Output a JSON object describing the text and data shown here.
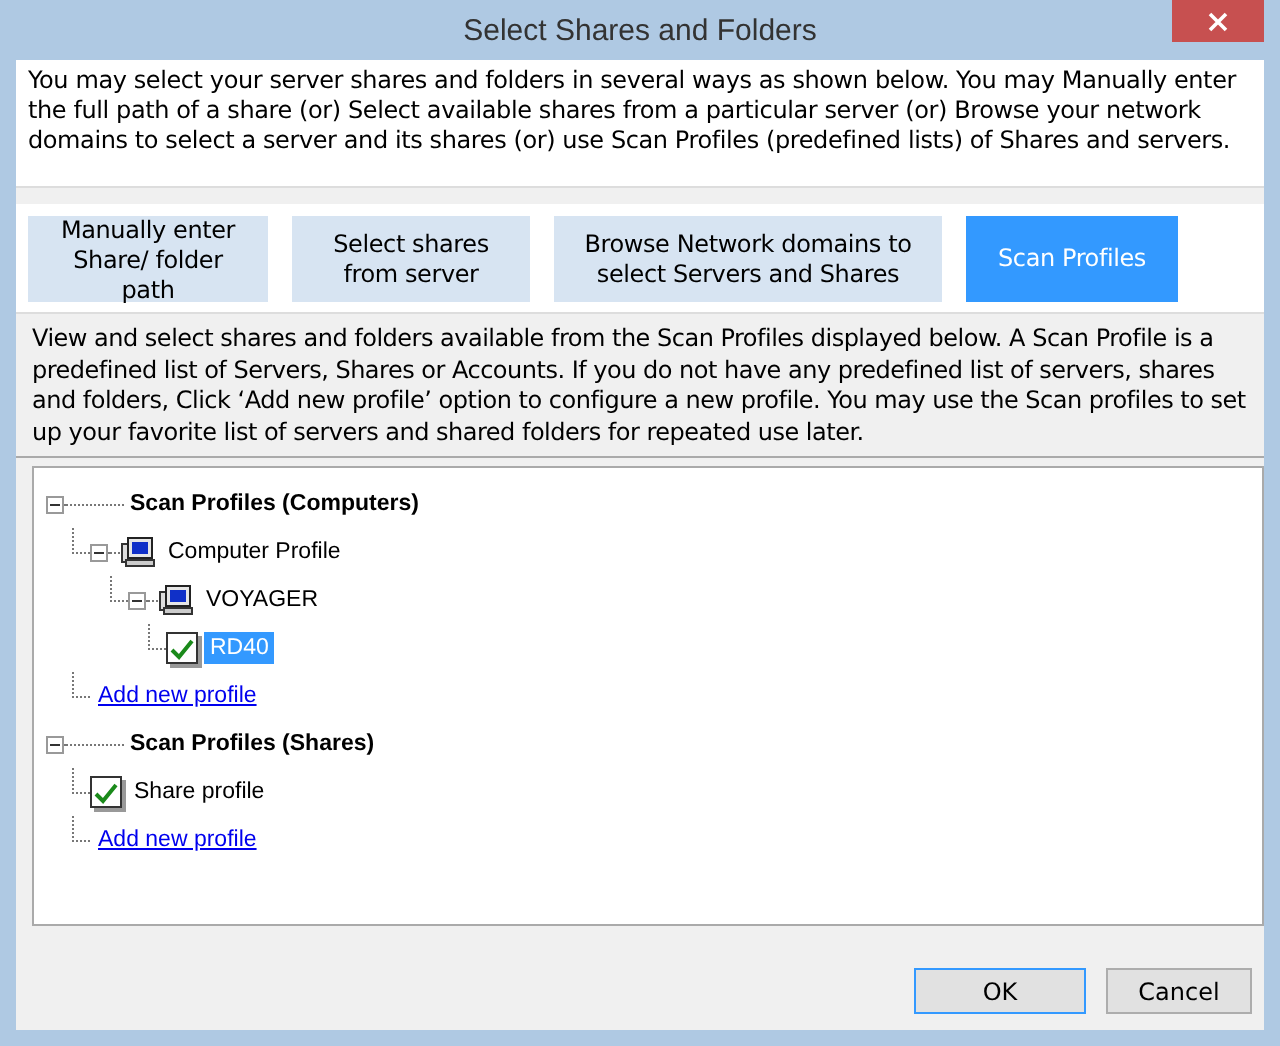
{
  "window": {
    "title": "Select Shares and Folders"
  },
  "intro": "You may select your server shares and folders in several ways as shown below. You may Manually enter the full path of a share (or) Select available shares from a particular server (or) Browse your network domains to select a server and its shares (or) use Scan Profiles (predefined lists) of Shares and servers.",
  "tabs": [
    {
      "label": "Manually enter Share/ folder path",
      "selected": false
    },
    {
      "label": "Select shares from server",
      "selected": false
    },
    {
      "label": "Browse Network domains to select Servers and Shares",
      "selected": false
    },
    {
      "label": "Scan Profiles",
      "selected": true
    }
  ],
  "description": "View and select shares and folders available from the Scan Profiles displayed below. A Scan Profile is a predefined list of Servers, Shares or Accounts. If you do not have any predefined list of servers, shares and folders, Click ‘Add new profile’ option to configure a new profile. You may use the Scan profiles to set up your favorite list of servers and shared folders for repeated use later.",
  "tree": [
    {
      "kind": "group",
      "label": "Scan Profiles (Computers)",
      "expanded": true,
      "children": [
        {
          "kind": "computer",
          "label": "Computer Profile",
          "expanded": true,
          "children": [
            {
              "kind": "computer",
              "label": "VOYAGER",
              "expanded": true,
              "children": [
                {
                  "kind": "check",
                  "label": "RD40",
                  "checked": true,
                  "selected": true
                }
              ]
            }
          ]
        },
        {
          "kind": "link",
          "label": "Add new profile"
        }
      ]
    },
    {
      "kind": "group",
      "label": "Scan Profiles (Shares)",
      "expanded": true,
      "children": [
        {
          "kind": "check",
          "label": "Share profile",
          "checked": true,
          "selected": false
        },
        {
          "kind": "link",
          "label": "Add new profile"
        }
      ]
    }
  ],
  "buttons": [
    {
      "label": "OK",
      "kind": "default"
    },
    {
      "label": "Cancel",
      "kind": "normal"
    }
  ]
}
